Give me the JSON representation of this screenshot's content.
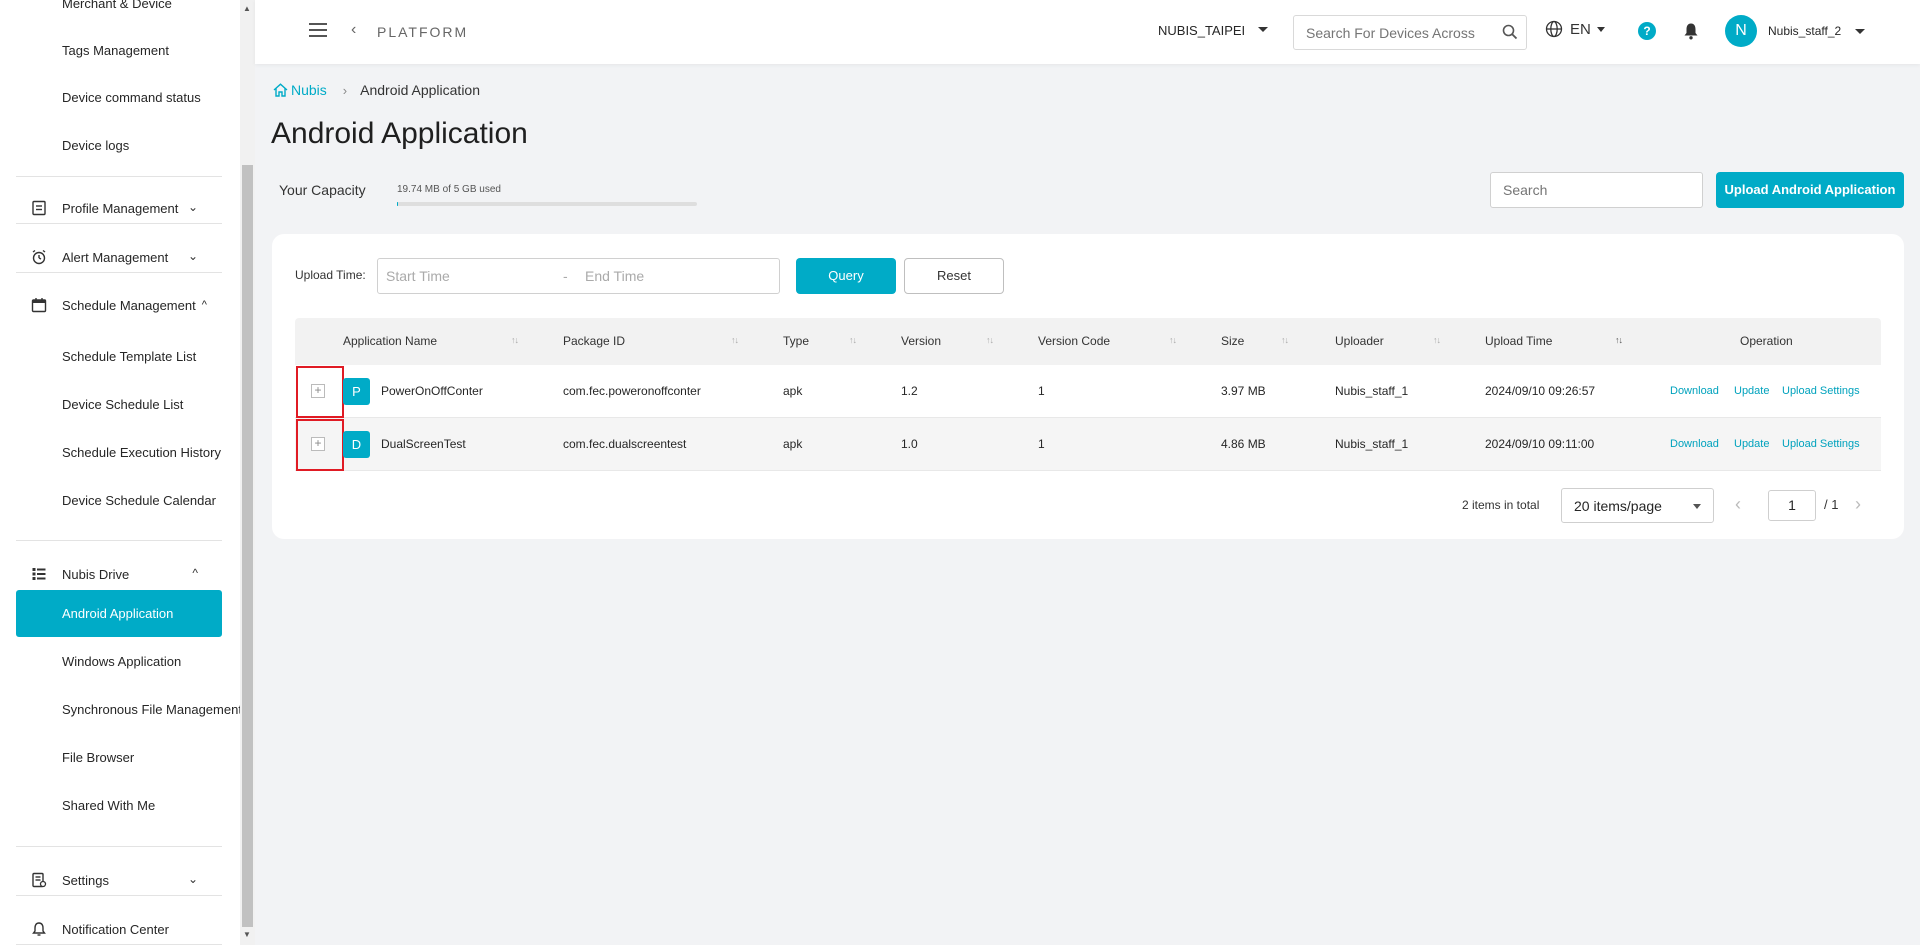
{
  "sidebar": {
    "top_partial": "Merchant & Device",
    "items_top": [
      "Tags Management",
      "Device command status",
      "Device logs"
    ],
    "groups": {
      "profile": "Profile Management",
      "alert": "Alert Management",
      "schedule": "Schedule Management",
      "drive": "Nubis Drive",
      "settings": "Settings",
      "notification": "Notification Center"
    },
    "schedule_items": [
      "Schedule Template List",
      "Device Schedule List",
      "Schedule Execution History",
      "Device Schedule Calendar"
    ],
    "drive_items": [
      "Android Application",
      "Windows Application",
      "Synchronous File Management",
      "File Browser",
      "Shared With Me"
    ]
  },
  "header": {
    "platform": "PLATFORM",
    "org": "NUBIS_TAIPEI",
    "search_placeholder": "Search For Devices Across",
    "lang": "EN",
    "help": "?",
    "avatar_letter": "N",
    "user": "Nubis_staff_2"
  },
  "breadcrumb": {
    "home": "Nubis",
    "current": "Android Application"
  },
  "page_title": "Android Application",
  "capacity": {
    "label": "Your Capacity",
    "text": "19.74 MB of 5 GB used",
    "fraction": 0.004
  },
  "search_placeholder": "Search",
  "upload_button": "Upload Android Application",
  "filter": {
    "label": "Upload Time:",
    "start": "Start Time",
    "dash": "-",
    "end": "End Time",
    "query": "Query",
    "reset": "Reset"
  },
  "table": {
    "columns": [
      "Application Name",
      "Package ID",
      "Type",
      "Version",
      "Version Code",
      "Size",
      "Uploader",
      "Upload Time",
      "Operation"
    ],
    "rows": [
      {
        "badge": "P",
        "name": "PowerOnOffConter",
        "package": "com.fec.poweronoffconter",
        "type": "apk",
        "version": "1.2",
        "code": "1",
        "size": "3.97 MB",
        "uploader": "Nubis_staff_1",
        "time": "2024/09/10 09:26:57"
      },
      {
        "badge": "D",
        "name": "DualScreenTest",
        "package": "com.fec.dualscreentest",
        "type": "apk",
        "version": "1.0",
        "code": "1",
        "size": "4.86 MB",
        "uploader": "Nubis_staff_1",
        "time": "2024/09/10 09:11:00"
      }
    ],
    "operations": [
      "Download",
      "Update",
      "Upload Settings"
    ]
  },
  "pagination": {
    "total": "2 items in total",
    "page_size": "20 items/page",
    "page": "1",
    "pages": "/ 1"
  },
  "colors": {
    "accent": "#00abc7",
    "highlight": "#e01b24"
  }
}
